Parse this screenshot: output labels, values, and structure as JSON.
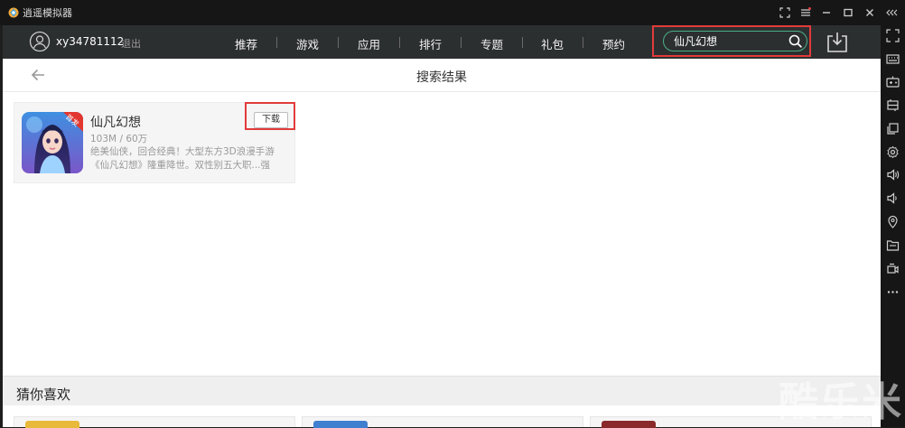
{
  "window": {
    "title": "逍遥模拟器"
  },
  "nav": {
    "username": "xy34781112",
    "logout_label": "退出",
    "items": [
      "推荐",
      "游戏",
      "应用",
      "排行",
      "专题",
      "礼包",
      "预约"
    ],
    "search_value": "仙凡幻想"
  },
  "page": {
    "title": "搜索结果"
  },
  "result": {
    "name": "仙凡幻想",
    "meta": "103M / 60万",
    "description": "绝美仙侠，回合经典！大型东方3D浪漫手游《仙凡幻想》隆重降世。双性别五大职...强",
    "download_label": "下载",
    "badge": "首发"
  },
  "guess": {
    "title": "猜你喜欢"
  },
  "watermark": "酷乐米",
  "colors": {
    "nav_bg": "#2c2f30",
    "accent_green": "#4caf86",
    "highlight_red": "#e23b3b",
    "sidebar_bg": "#161616"
  }
}
